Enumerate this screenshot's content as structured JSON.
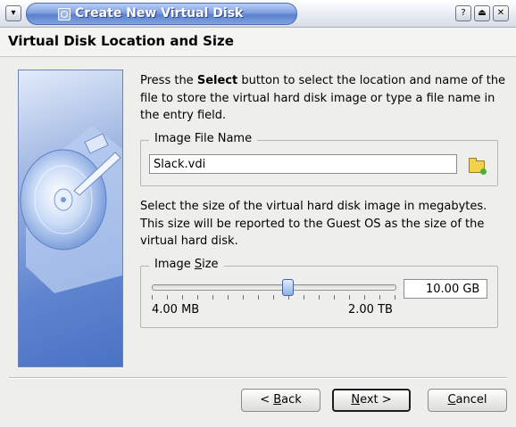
{
  "window": {
    "title": "Create New Virtual Disk"
  },
  "header": {
    "title": "Virtual Disk Location and Size"
  },
  "location": {
    "intro_before": "Press the ",
    "intro_bold": "Select",
    "intro_after": " button to select the location and name of the file to store the virtual hard disk image or type a file name in the entry field.",
    "group_title": "Image File Name",
    "file_name": "Slack.vdi"
  },
  "size": {
    "intro": "Select the size of the virtual hard disk image in megabytes. This size will be reported to the Guest OS as the size of the virtual hard disk.",
    "group_title_prefix": "Image ",
    "group_title_mnemonic": "S",
    "group_title_suffix": "ize",
    "min_label": "4.00 MB",
    "max_label": "2.00 TB",
    "value": "10.00 GB",
    "slider_position": 0.56
  },
  "buttons": {
    "back_prefix": "< ",
    "back_mnemonic": "B",
    "back_suffix": "ack",
    "next_mnemonic": "N",
    "next_suffix": "ext >",
    "cancel_mnemonic": "C",
    "cancel_suffix": "ancel"
  },
  "icons": {
    "window_menu": "window-menu-icon",
    "title_app": "virtualbox-title-icon",
    "help": "help-icon",
    "shade": "shade-icon",
    "close": "close-icon",
    "folder": "folder-select-icon"
  }
}
